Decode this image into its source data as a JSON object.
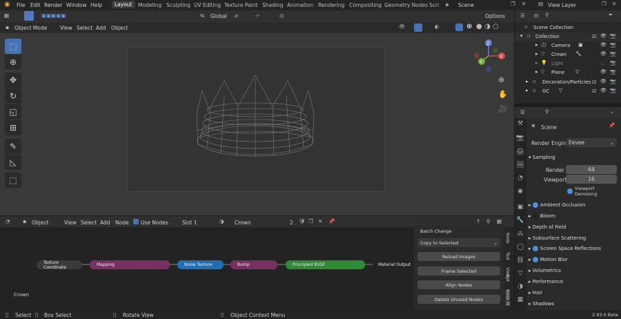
{
  "topbar": {
    "menus": [
      "File",
      "Edit",
      "Render",
      "Window",
      "Help"
    ],
    "workspaces": [
      "Layout",
      "Modeling",
      "Sculpting",
      "UV Editing",
      "Texture Paint",
      "Shading",
      "Animation",
      "Rendering",
      "Compositing",
      "Geometry Nodes",
      "Scri"
    ],
    "scene": "Scene",
    "view_layer": "View Layer"
  },
  "viewport": {
    "transform": "Global",
    "options": "Options",
    "mode": "Object Mode",
    "menus": [
      "View",
      "Select",
      "Add",
      "Object"
    ],
    "gizmo": {
      "x": "X",
      "y": "Y",
      "z": "Z"
    }
  },
  "node_editor": {
    "type": "Object",
    "menus": [
      "View",
      "Select",
      "Add",
      "Node"
    ],
    "use_nodes": "Use Nodes",
    "slot": "Slot 1",
    "material": "Crown",
    "users": "2",
    "label": "Crown",
    "nodes": [
      "Texture Coordinate",
      "Mapping",
      "Noise Texture",
      "Bump",
      "Principled BSDF",
      "Material Output"
    ],
    "panel": [
      "Batch Change",
      "Copy to Selected",
      "Reload Images",
      "Frame Selected",
      "Align Nodes",
      "Delete Unused Nodes"
    ],
    "tabs": [
      "Node",
      "Tool",
      "View",
      "Opt",
      "Node W"
    ]
  },
  "outliner": {
    "root": "Scene Collection",
    "items": [
      "Collection",
      "Camera",
      "Crown",
      "Light",
      "Plane",
      "Decoration/Particles",
      "GC"
    ]
  },
  "properties": {
    "scene": "Scene",
    "render_engine_label": "Render Engine",
    "render_engine": "Eevee",
    "sampling": "Sampling",
    "render_label": "Render",
    "render_value": "64",
    "viewport_label": "Viewport",
    "viewport_value": "16",
    "denoise": "Viewport Denoising",
    "sections": [
      "Ambient Occlusion",
      "Bloom",
      "Depth of Field",
      "Subsurface Scattering",
      "Screen Space Reflections",
      "Motion Blur",
      "Volumetrics",
      "Performance",
      "Hair",
      "Shadows"
    ]
  },
  "status": {
    "select": "Select",
    "box": "Box Select",
    "rotate": "Rotate View",
    "context": "Object Context Menu",
    "version": "2.93.0 Beta"
  },
  "colors": {
    "accent": "#4772b3",
    "mapping": "#7a2f63",
    "noise": "#1f6fb8",
    "bsdf": "#2f8a34"
  }
}
